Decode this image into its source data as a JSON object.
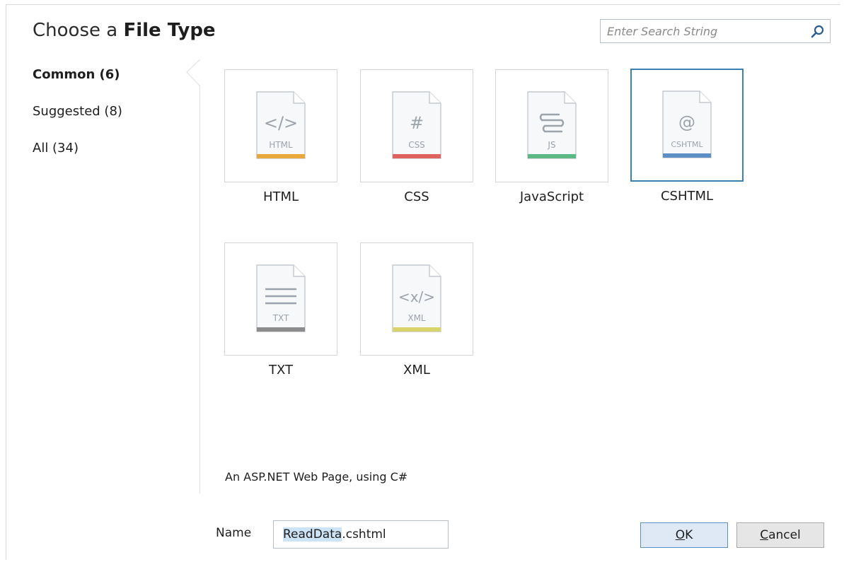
{
  "dialog": {
    "title_prefix": "Choose a",
    "title_bold": "File Type"
  },
  "search": {
    "placeholder": "Enter Search String",
    "icon": "search-icon"
  },
  "sidebar": {
    "items": [
      {
        "label": "Common (6)",
        "active": true
      },
      {
        "label": "Suggested (8)",
        "active": false
      },
      {
        "label": "All (34)",
        "active": false
      }
    ]
  },
  "file_types": [
    {
      "name": "HTML",
      "glyph": "</>",
      "badge": "HTML",
      "color": "#e8a93a",
      "icon": "html-file-icon"
    },
    {
      "name": "CSS",
      "glyph": "#",
      "badge": "CSS",
      "color": "#e0625e",
      "icon": "css-file-icon"
    },
    {
      "name": "JavaScript",
      "glyph": "",
      "badge": "JS",
      "color": "#5cb884",
      "icon": "javascript-file-icon"
    },
    {
      "name": "CSHTML",
      "glyph": "@",
      "badge": "CSHTML",
      "color": "#5b8fc5",
      "icon": "cshtml-file-icon",
      "selected": true
    },
    {
      "name": "TXT",
      "glyph": "",
      "badge": "TXT",
      "color": "#8c8c8c",
      "icon": "txt-file-icon"
    },
    {
      "name": "XML",
      "glyph": "<x/>",
      "badge": "XML",
      "color": "#d9d46a",
      "icon": "xml-file-icon"
    }
  ],
  "description": "An ASP.NET Web Page, using C#",
  "name_field": {
    "label": "Name",
    "value_selected": "ReadData",
    "value_rest": ".cshtml"
  },
  "buttons": {
    "ok_mnemonic": "O",
    "ok_rest": "K",
    "cancel_mnemonic": "C",
    "cancel_rest": "ancel"
  }
}
